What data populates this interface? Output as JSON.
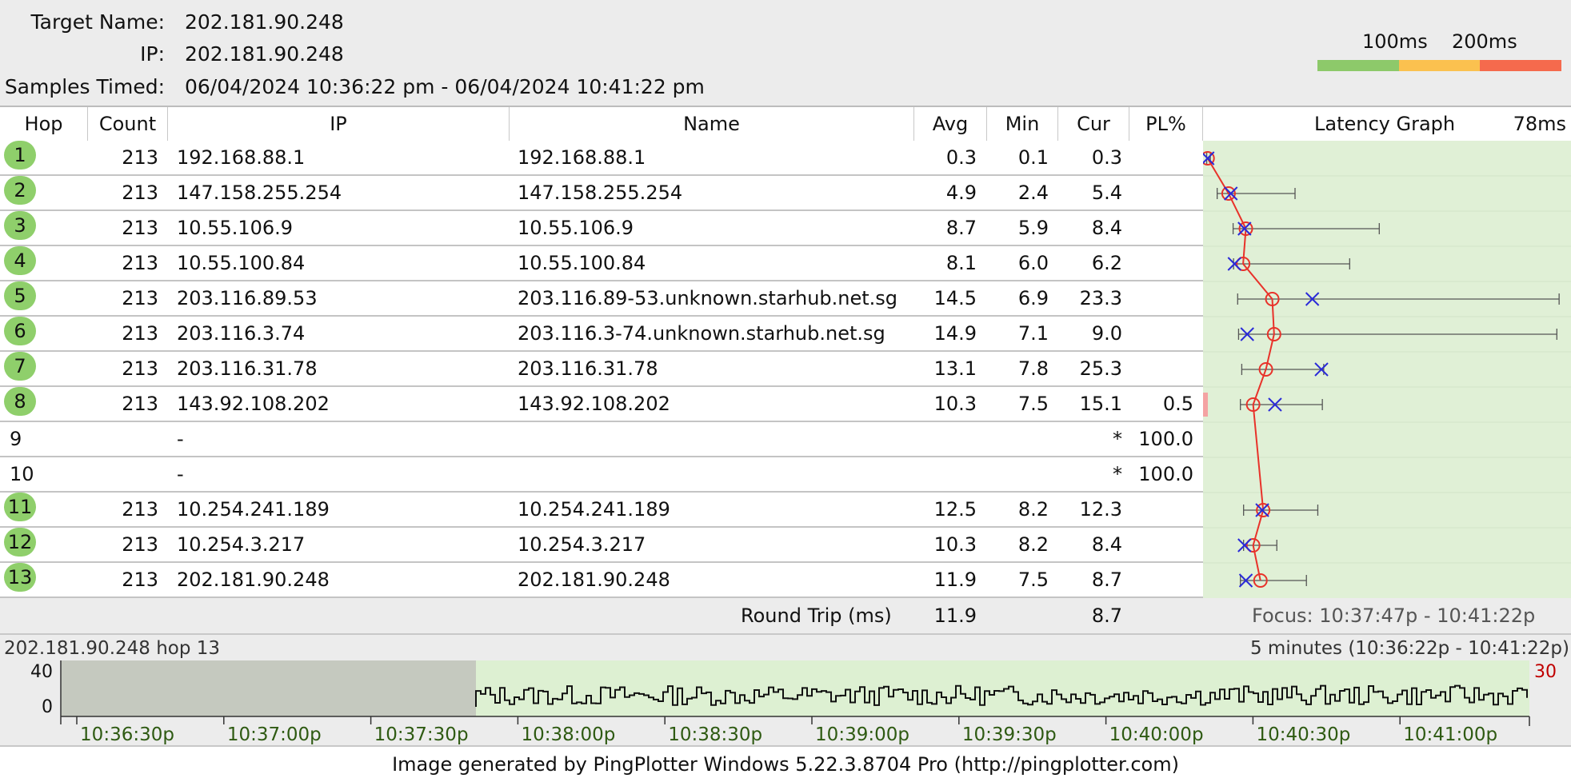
{
  "header": {
    "target_label": "Target Name:",
    "target_value": "202.181.90.248",
    "ip_label": "IP:",
    "ip_value": "202.181.90.248",
    "samples_label": "Samples Timed:",
    "samples_value": "06/04/2024 10:36:22 pm - 06/04/2024 10:41:22 pm"
  },
  "legend": {
    "label_100": "100ms",
    "label_200": "200ms",
    "colors": [
      "#8dc96a",
      "#fbc14f",
      "#f56a4d"
    ]
  },
  "columns": {
    "hop": "Hop",
    "count": "Count",
    "ip": "IP",
    "name": "Name",
    "avg": "Avg",
    "min": "Min",
    "cur": "Cur",
    "pl": "PL%",
    "graph": "Latency Graph",
    "graph_scale": "78ms"
  },
  "graph_scale_ms": 78,
  "rows": [
    {
      "hop": "1",
      "count": "213",
      "ip": "192.168.88.1",
      "name": "192.168.88.1",
      "avg": "0.3",
      "min": "0.1",
      "cur": "0.3",
      "pl": "",
      "max": 0.9,
      "responding": true
    },
    {
      "hop": "2",
      "count": "213",
      "ip": "147.158.255.254",
      "name": "147.158.255.254",
      "avg": "4.9",
      "min": "2.4",
      "cur": "5.4",
      "pl": "",
      "max": 19.5,
      "responding": true
    },
    {
      "hop": "3",
      "count": "213",
      "ip": "10.55.106.9",
      "name": "10.55.106.9",
      "avg": "8.7",
      "min": "5.9",
      "cur": "8.4",
      "pl": "",
      "max": 38.0,
      "responding": true
    },
    {
      "hop": "4",
      "count": "213",
      "ip": "10.55.100.84",
      "name": "10.55.100.84",
      "avg": "8.1",
      "min": "6.0",
      "cur": "6.2",
      "pl": "",
      "max": 31.5,
      "responding": true
    },
    {
      "hop": "5",
      "count": "213",
      "ip": "203.116.89.53",
      "name": "203.116.89-53.unknown.starhub.net.sg",
      "avg": "14.5",
      "min": "6.9",
      "cur": "23.3",
      "pl": "",
      "max": 77.5,
      "responding": true
    },
    {
      "hop": "6",
      "count": "213",
      "ip": "203.116.3.74",
      "name": "203.116.3-74.unknown.starhub.net.sg",
      "avg": "14.9",
      "min": "7.1",
      "cur": "9.0",
      "pl": "",
      "max": 77.0,
      "responding": true
    },
    {
      "hop": "7",
      "count": "213",
      "ip": "203.116.31.78",
      "name": "203.116.31.78",
      "avg": "13.1",
      "min": "7.8",
      "cur": "25.3",
      "pl": "",
      "max": 25.8,
      "responding": true
    },
    {
      "hop": "8",
      "count": "213",
      "ip": "143.92.108.202",
      "name": "143.92.108.202",
      "avg": "10.3",
      "min": "7.5",
      "cur": "15.1",
      "pl": "0.5",
      "max": 25.5,
      "responding": true
    },
    {
      "hop": "9",
      "count": "",
      "ip": "-",
      "name": "",
      "avg": "",
      "min": "",
      "cur": "*",
      "pl": "100.0",
      "responding": false
    },
    {
      "hop": "10",
      "count": "",
      "ip": "-",
      "name": "",
      "avg": "",
      "min": "",
      "cur": "*",
      "pl": "100.0",
      "responding": false
    },
    {
      "hop": "11",
      "count": "213",
      "ip": "10.254.241.189",
      "name": "10.254.241.189",
      "avg": "12.5",
      "min": "8.2",
      "cur": "12.3",
      "pl": "",
      "max": 24.5,
      "responding": true
    },
    {
      "hop": "12",
      "count": "213",
      "ip": "10.254.3.217",
      "name": "10.254.3.217",
      "avg": "10.3",
      "min": "8.2",
      "cur": "8.4",
      "pl": "",
      "max": 15.5,
      "responding": true
    },
    {
      "hop": "13",
      "count": "213",
      "ip": "202.181.90.248",
      "name": "202.181.90.248",
      "avg": "11.9",
      "min": "7.5",
      "cur": "8.7",
      "pl": "",
      "max": 22.0,
      "responding": true
    }
  ],
  "summary": {
    "label": "Round Trip (ms)",
    "avg": "11.9",
    "cur": "8.7",
    "focus": "Focus: 10:37:47p - 10:41:22p"
  },
  "timeline": {
    "left_title": "202.181.90.248 hop 13",
    "right_title": "5 minutes (10:36:22p - 10:41:22p)",
    "y_top": "40",
    "y_bottom": "0",
    "scale_max": "30",
    "ticks": [
      "10:36:30p",
      "10:37:00p",
      "10:37:30p",
      "10:38:00p",
      "10:38:30p",
      "10:39:00p",
      "10:39:30p",
      "10:40:00p",
      "10:40:30p",
      "10:41:00p"
    ],
    "seed": 13
  },
  "footer": "Image generated by PingPlotter Windows 5.22.3.8704 Pro (http://pingplotter.com)"
}
